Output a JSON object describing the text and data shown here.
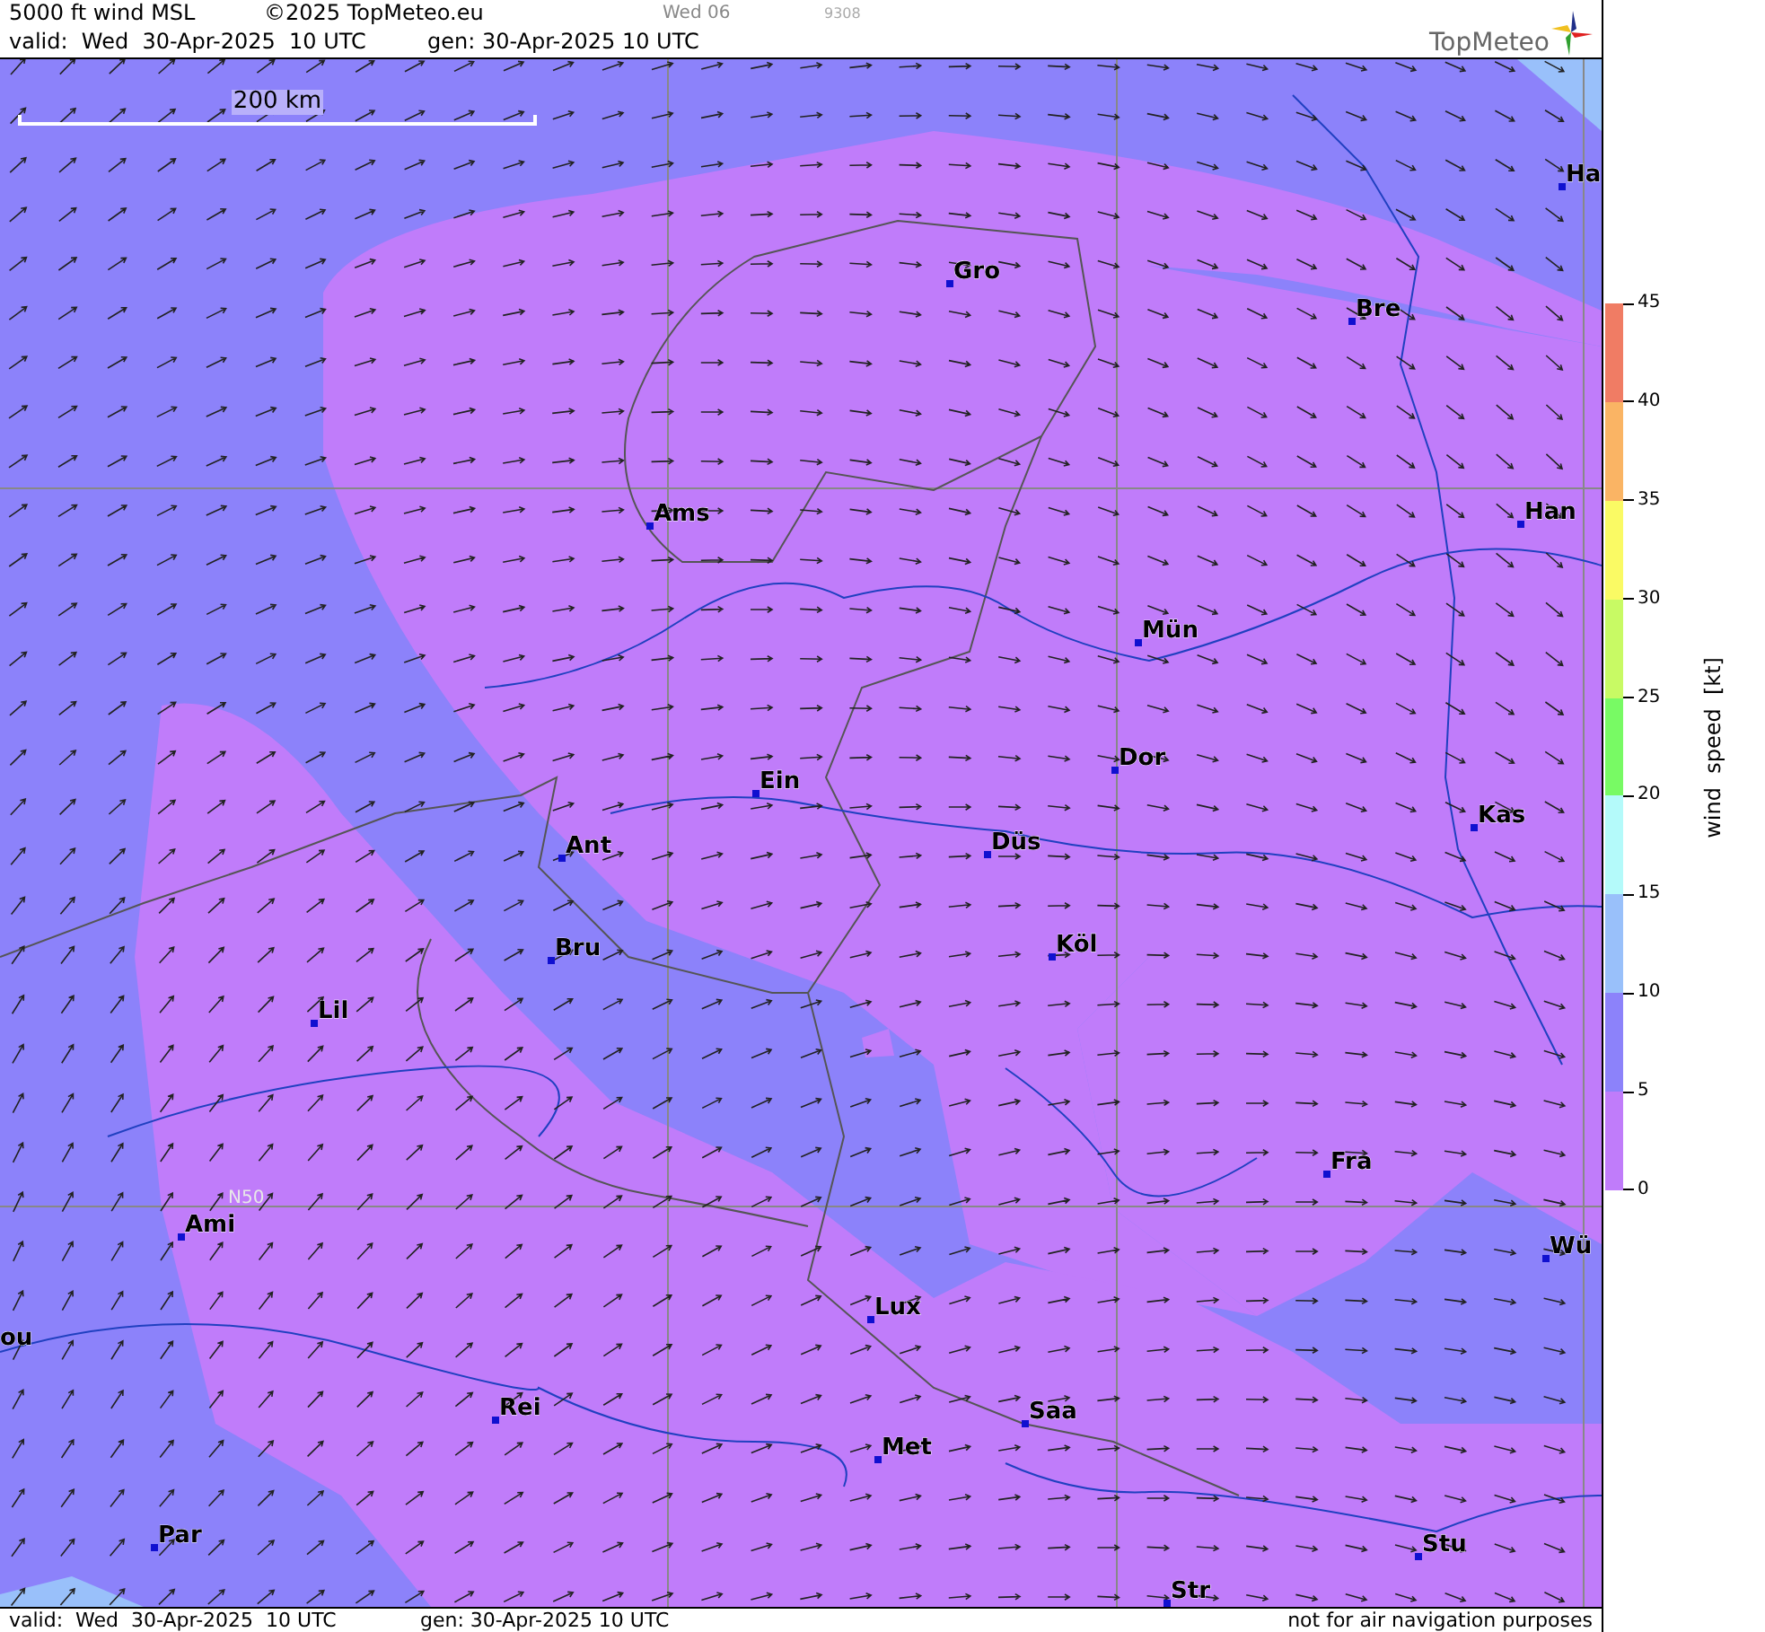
{
  "header": {
    "title": "5000 ft wind MSL",
    "copyright": "©2025 TopMeteo.eu",
    "run_day": "Wed 06",
    "code": "9308",
    "valid": "valid:  Wed  30-Apr-2025  10 UTC",
    "generated": "gen: 30-Apr-2025 10 UTC",
    "logo": "TopMeteo"
  },
  "map": {
    "scale": "200 km",
    "latitude_label": "N50",
    "cities": [
      {
        "name": "Ha"
      },
      {
        "name": "Gro"
      },
      {
        "name": "Bre"
      },
      {
        "name": "Ams"
      },
      {
        "name": "Han"
      },
      {
        "name": "Mün"
      },
      {
        "name": "Dor"
      },
      {
        "name": "Ein"
      },
      {
        "name": "Kas"
      },
      {
        "name": "Düs"
      },
      {
        "name": "Ant"
      },
      {
        "name": "Köl"
      },
      {
        "name": "Bru"
      },
      {
        "name": "Lil"
      },
      {
        "name": "Fra"
      },
      {
        "name": "Ami"
      },
      {
        "name": "Wü"
      },
      {
        "name": "Lux"
      },
      {
        "name": "ou"
      },
      {
        "name": "Rei"
      },
      {
        "name": "Saa"
      },
      {
        "name": "Met"
      },
      {
        "name": "Par"
      },
      {
        "name": "Stu"
      },
      {
        "name": "Str"
      }
    ]
  },
  "legend": {
    "label": "wind  speed  [kt]",
    "ticks": [
      "45",
      "40",
      "35",
      "30",
      "25",
      "20",
      "15",
      "10",
      "5",
      "0"
    ],
    "bands": [
      {
        "color": "#f07c64"
      },
      {
        "color": "#fab464"
      },
      {
        "color": "#fafa64"
      },
      {
        "color": "#c8fa64"
      },
      {
        "color": "#78fa64"
      },
      {
        "color": "#b4fafa"
      },
      {
        "color": "#99c0fa"
      },
      {
        "color": "#8c82fa"
      },
      {
        "color": "#c07cfa"
      }
    ]
  },
  "footer": {
    "valid": "valid:  Wed  30-Apr-2025  10 UTC",
    "generated": "gen: 30-Apr-2025 10 UTC",
    "disclaimer": "not for air navigation purposes"
  }
}
